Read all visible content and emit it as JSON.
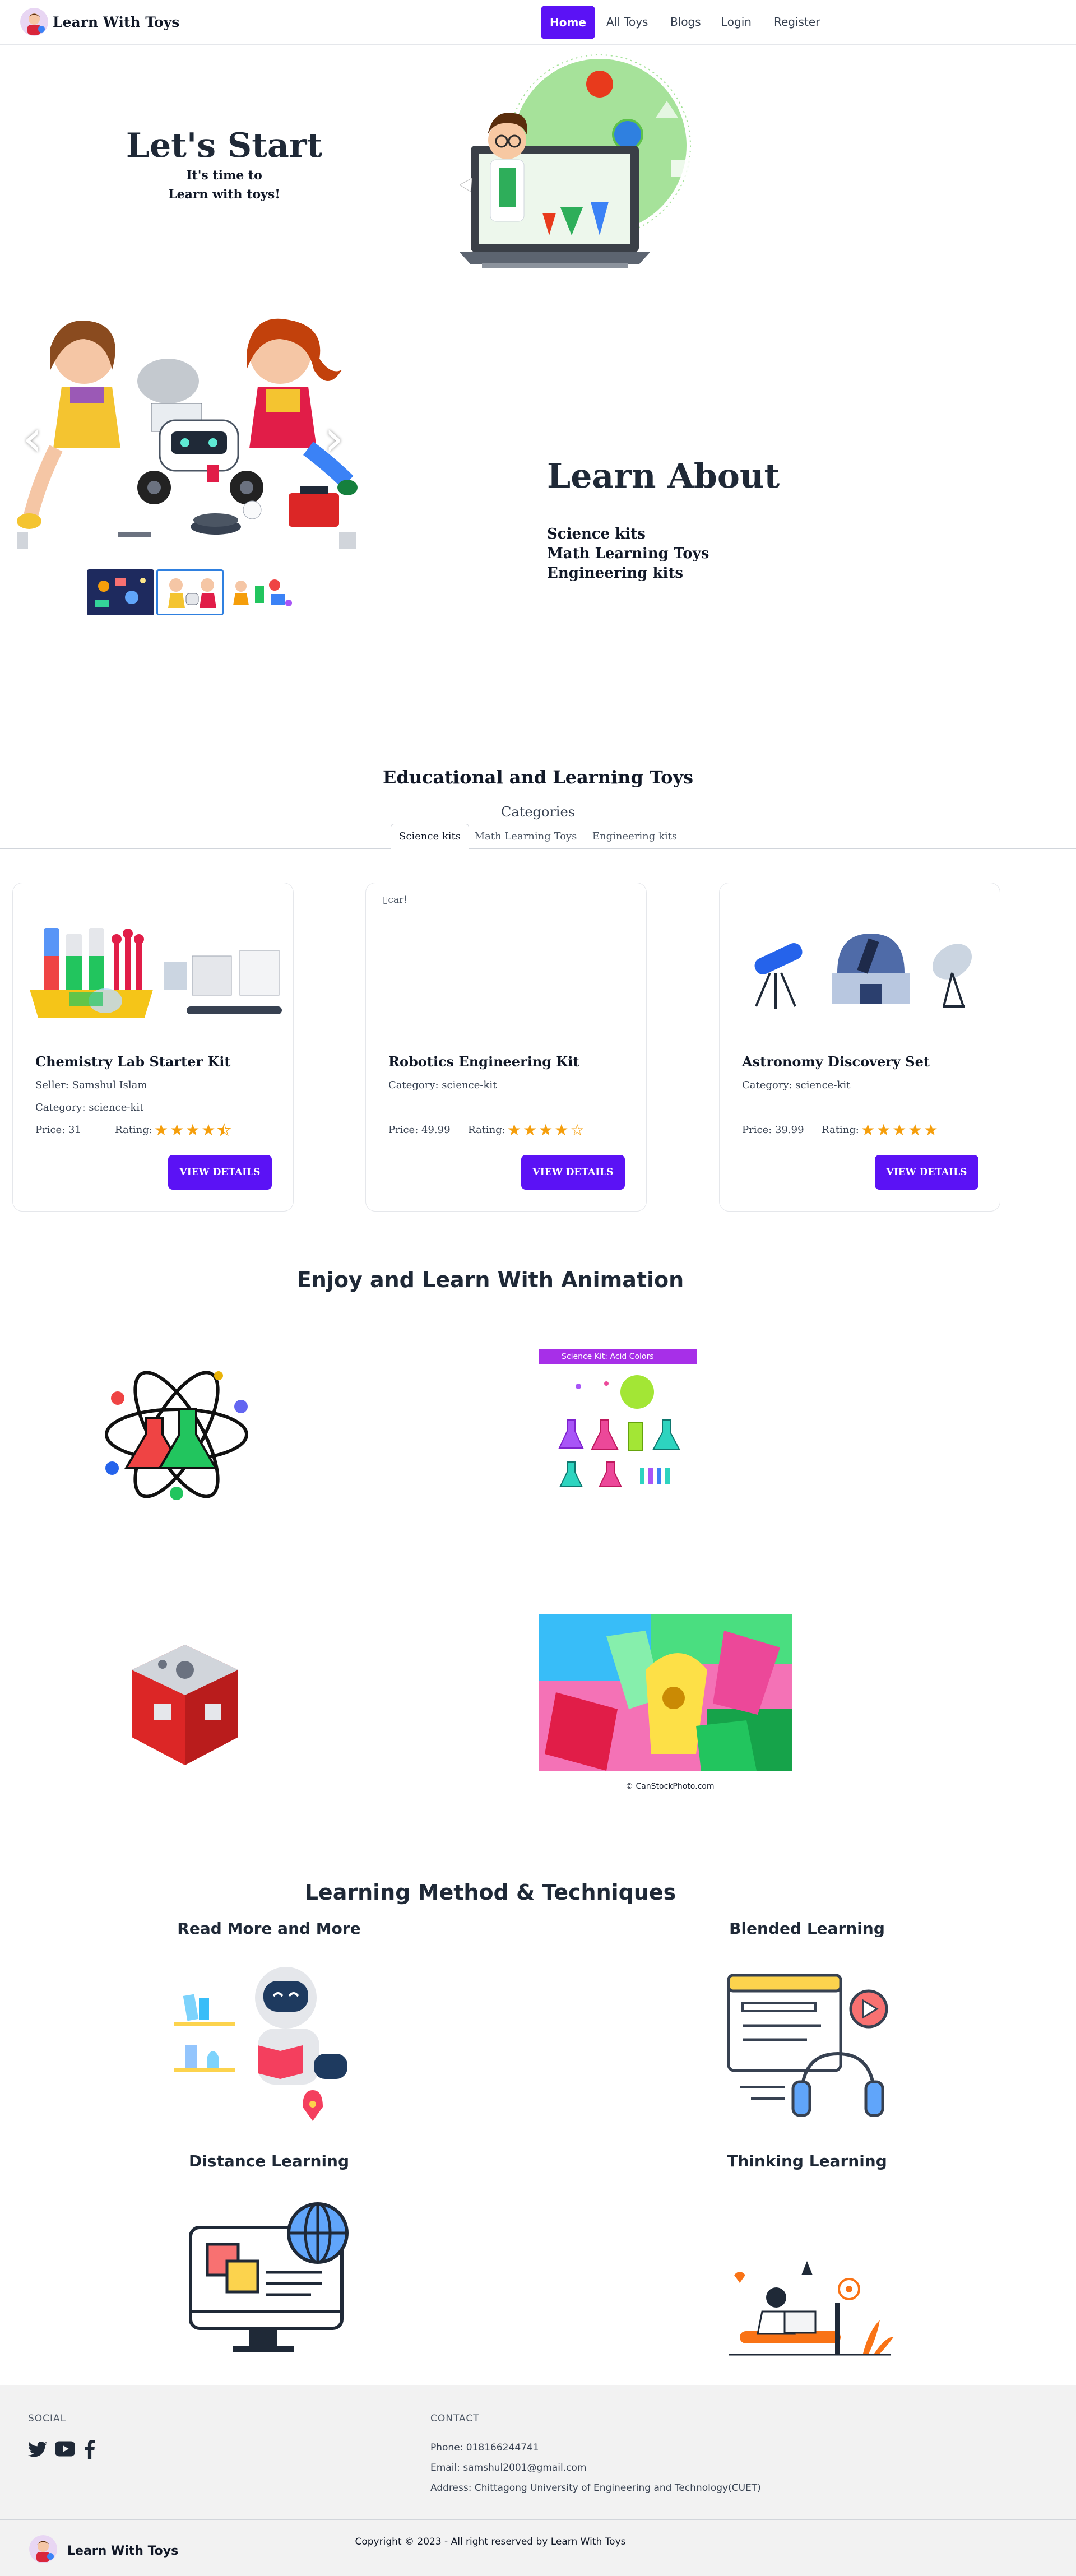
{
  "nav": {
    "brand": "Learn With Toys",
    "links": [
      "Home",
      "All Toys",
      "Blogs",
      "Login",
      "Register"
    ],
    "accent": "#5b12f5"
  },
  "hero": {
    "title": "Let's Start",
    "subtitle_line1": "It's time to",
    "subtitle_line2": "Learn with toys!"
  },
  "learn_about": {
    "title": "Learn About",
    "items": [
      "Science kits",
      "Math Learning Toys",
      "Engineering kits"
    ]
  },
  "toys": {
    "heading": "Educational and Learning Toys",
    "categories_label": "Categories",
    "tabs": [
      "Science kits",
      "Math Learning Toys",
      "Engineering kits"
    ],
    "cards": [
      {
        "title": "Chemistry Lab Starter Kit",
        "seller": "Seller: Samshul Islam",
        "category": "Category: science-kit",
        "price": "Price: 31",
        "rating_label": "Rating:",
        "rating": 4.5,
        "button": "VIEW DETAILS"
      },
      {
        "title": "Robotics Engineering Kit",
        "category": "Category: science-kit",
        "price": "Price: 49.99",
        "rating_label": "Rating:",
        "rating": 4,
        "button": "VIEW DETAILS",
        "broken_image_alt": "car!"
      },
      {
        "title": "Astronomy Discovery Set",
        "category": "Category: science-kit",
        "price": "Price: 39.99",
        "rating_label": "Rating:",
        "rating": 5,
        "button": "VIEW DETAILS"
      }
    ]
  },
  "animation": {
    "heading": "Enjoy and Learn With Animation",
    "kit_banner": "Science Kit: Acid Colors",
    "credit": "© CanStockPhoto.com"
  },
  "methods": {
    "heading": "Learning Method & Techniques",
    "items": [
      "Read More and More",
      "Blended Learning",
      "Distance Learning",
      "Thinking Learning"
    ]
  },
  "footer": {
    "social_heading": "SOCIAL",
    "contact_heading": "CONTACT",
    "phone": "Phone: 018166244741",
    "email": "Email: samshul2001@gmail.com",
    "address": "Address: Chittagong University of Engineering and Technology(CUET)",
    "brand": "Learn With Toys",
    "copyright": "Copyright © 2023 - All right reserved by Learn With Toys"
  }
}
